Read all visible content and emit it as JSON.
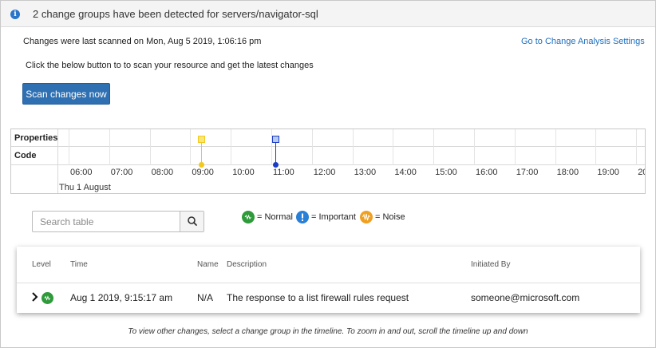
{
  "banner": {
    "text": "2 change groups have been detected for servers/navigator-sql",
    "icon": "info-icon"
  },
  "header": {
    "last_scanned": "Changes were last scanned on Mon, Aug 5 2019, 1:06:16 pm",
    "settings_link": "Go to Change Analysis Settings",
    "instruction": "Click the below button to to scan your resource and get the latest changes",
    "scan_button": "Scan changes now"
  },
  "timeline": {
    "rows": [
      "Properties",
      "Code"
    ],
    "ticks": [
      "06:00",
      "07:00",
      "08:00",
      "09:00",
      "10:00",
      "11:00",
      "12:00",
      "13:00",
      "14:00",
      "15:00",
      "16:00",
      "17:00",
      "18:00",
      "19:00",
      "20"
    ],
    "date": "Thu 1 August",
    "markers": [
      {
        "time": "09:15",
        "row": "Properties",
        "color": "#f2c81b",
        "fill": "#f7e77a"
      },
      {
        "time": "11:05",
        "row": "Properties",
        "color": "#1a3cc7",
        "fill": "#b8c9ee"
      }
    ]
  },
  "search": {
    "placeholder": "Search table",
    "icon": "search-icon"
  },
  "legend": {
    "normal": "= Normal",
    "important": "= Important",
    "noise": "= Noise",
    "colors": {
      "normal": "#2e9a3a",
      "important": "#2a7fd6",
      "noise": "#f0a020"
    }
  },
  "table": {
    "headers": {
      "level": "Level",
      "time": "Time",
      "name": "Name",
      "description": "Description",
      "initiated_by": "Initiated By"
    },
    "rows": [
      {
        "level": "normal",
        "time": "Aug 1 2019, 9:15:17 am",
        "name": "N/A",
        "description": "The response to a list firewall rules request",
        "initiated_by": "someone@microsoft.com"
      }
    ]
  },
  "footer": "To view other changes, select a change group in the timeline. To zoom in and out, scroll the timeline up and down"
}
